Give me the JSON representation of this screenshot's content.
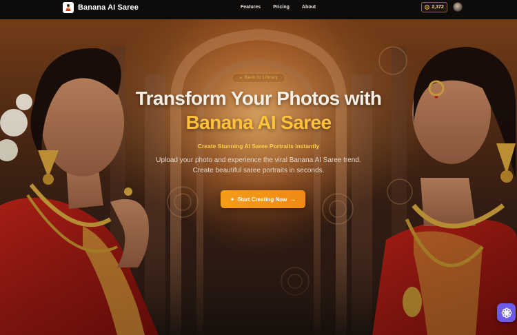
{
  "header": {
    "brand_name": "Banana AI Saree",
    "nav": [
      "Features",
      "Pricing",
      "About"
    ],
    "credits": "2,372"
  },
  "hero": {
    "badge": "Back to Library",
    "title_line1": "Transform Your Photos with",
    "title_line2": "Banana AI Saree",
    "tagline": "Create Stunning AI Saree Portraits Instantly",
    "description_line1": "Upload your photo and experience the viral Banana AI Saree trend.",
    "description_line2": "Create beautiful saree portraits in seconds.",
    "cta_label": "Start Creating Now"
  },
  "icons": {
    "logo": "banana-person-icon",
    "credits": "coin-icon",
    "cta_leading": "sparkle-icon",
    "cta_trailing": "arrow-right-icon",
    "help": "flower-help-icon"
  },
  "colors": {
    "header_bg": "#0d0c0b",
    "title_white": "#f6efe6",
    "title_gold": "#ffc23a",
    "cta": "#f49c18",
    "help_button": "#6c5ce7"
  }
}
